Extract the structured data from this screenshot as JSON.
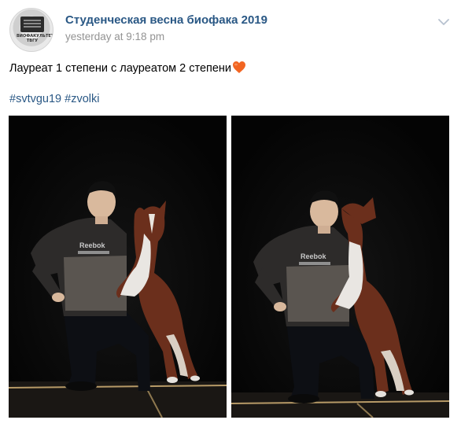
{
  "post": {
    "author": "Студенческая весна биофака 2019",
    "timestamp": "yesterday at 9:18 pm",
    "text": "Лауреат 1 степени с лауреатом 2 степени",
    "emoji": "orange-heart-emoji",
    "hashtags": [
      "#svtvgu19",
      "#zvolki"
    ],
    "avatar_text": "ВИОФАКУЛЬТЕТ ТВГУ",
    "photos": [
      {
        "icon": "photo-man-with-dog",
        "shirt_text": "Reebok"
      },
      {
        "icon": "photo-dog-licking-man",
        "shirt_text": "Reebok"
      }
    ]
  },
  "colors": {
    "link": "#2a5885",
    "meta": "#939393",
    "heart": "#f26522",
    "photo_bg": "#050505"
  }
}
